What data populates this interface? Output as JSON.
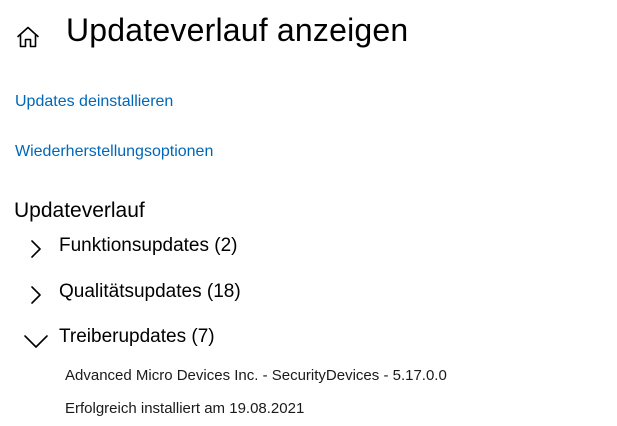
{
  "header": {
    "title": "Updateverlauf anzeigen",
    "home_icon": "home-icon"
  },
  "links": {
    "uninstall": "Updates deinstallieren",
    "recovery": "Wiederherstellungsoptionen",
    "color": "#0067b8"
  },
  "history": {
    "title": "Updateverlauf",
    "groups": [
      {
        "label": "Funktionsupdates (2)",
        "expanded": false,
        "icon": "chevron-right-icon"
      },
      {
        "label": "Qualitätsupdates (18)",
        "expanded": false,
        "icon": "chevron-right-icon"
      },
      {
        "label": "Treiberupdates (7)",
        "expanded": true,
        "icon": "chevron-down-icon",
        "items": [
          {
            "name": "Advanced Micro Devices Inc. - SecurityDevices - 5.17.0.0",
            "status": "Erfolgreich installiert am 19.08.2021"
          }
        ]
      }
    ]
  }
}
